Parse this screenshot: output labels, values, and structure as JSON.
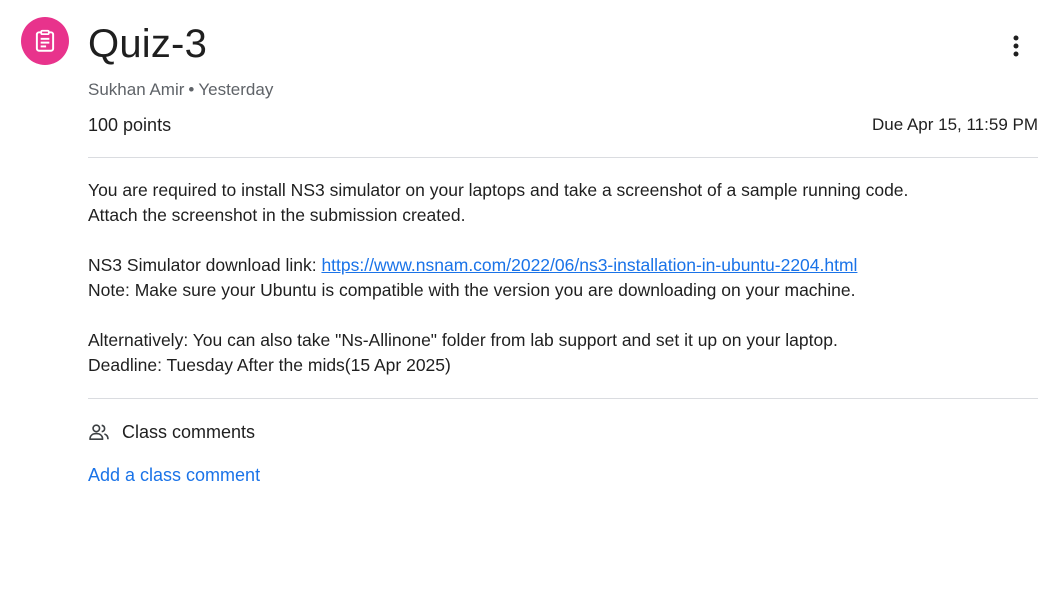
{
  "assignment": {
    "icon": "assignment-icon",
    "icon_bg_color": "#e8338c",
    "title": "Quiz-3",
    "author": "Sukhan Amir",
    "separator": "•",
    "posted": "Yesterday",
    "points": "100 points",
    "due": "Due Apr 15, 11:59 PM",
    "more_icon": "more-vert-icon"
  },
  "description": {
    "line1": "You are required to install NS3 simulator  on your laptops and take a screenshot of a sample running code.",
    "line2": "Attach the screenshot in the submission created.",
    "link_prefix": "NS3 Simulator download link: ",
    "link_text": "https://www.nsnam.com/2022/06/ns3-installation-in-ubuntu-2204.html",
    "link_href": "https://www.nsnam.com/2022/06/ns3-installation-in-ubuntu-2204.html",
    "line4": "Note: Make sure your Ubuntu is compatible with the version you are downloading on your machine.",
    "line5": "Alternatively: You can also take \"Ns-Allinone\" folder from lab support and set it up on your laptop.",
    "line6": "Deadline: Tuesday After the mids(15 Apr 2025)"
  },
  "comments": {
    "icon": "people-icon",
    "header": "Class comments",
    "add_label": "Add a class comment"
  },
  "colors": {
    "link": "#1a73e8",
    "divider": "#dadce0",
    "secondary_text": "#5f6368"
  }
}
